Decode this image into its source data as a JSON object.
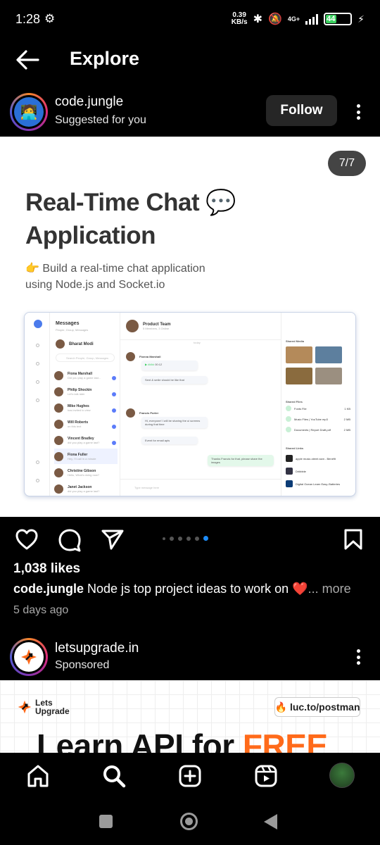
{
  "status": {
    "time": "1:28",
    "net_speed_value": "0.39",
    "net_speed_unit": "KB/s",
    "network": "4G+",
    "battery": "44"
  },
  "header": {
    "title": "Explore"
  },
  "post": {
    "username": "code.jungle",
    "subtitle": "Suggested for you",
    "follow_label": "Follow",
    "slide_counter": "7/7",
    "image": {
      "title_line1": "Real-Time Chat 💬",
      "title_line2": "Application",
      "desc_line1": "👉 Build a real-time chat application",
      "desc_line2": "using Node.js and Socket.io",
      "mock": {
        "messages_title": "Messages",
        "messages_sub": "People, Group, Messages",
        "me_name": "Bharat Modi",
        "search_placeholder": "Search People, Group, Messages",
        "contacts": [
          {
            "name": "Fiona Marshall",
            "preview": "Did you play a game last..."
          },
          {
            "name": "Philip Shockin",
            "preview": "Let's talk later"
          },
          {
            "name": "Mike Hughes",
            "preview": "has invited to view"
          },
          {
            "name": "Will Roberts",
            "preview": "on this text"
          },
          {
            "name": "Vincent Bradley",
            "preview": "did you play a game last?"
          },
          {
            "name": "Fiona Fuller",
            "preview": "Hey, I'll call in a minute"
          },
          {
            "name": "Christine Gibson",
            "preview": "Hello, What's doing now?"
          },
          {
            "name": "Janet Jackson",
            "preview": "did you play a game last?"
          }
        ],
        "chat_title": "Product Team",
        "chat_sub": "5 Members, 3 Online",
        "today": "today",
        "sender1": "Fionna Marshall",
        "msg_audio_time": "00:12",
        "msg1": "Sent & smile should be like that",
        "sender2": "Francis Porter",
        "msg2": "Hi, everyone! I will be sharing the ui screens during that time",
        "msg3": "Event for email apis",
        "msg4": "Thanks Francis for that, please share the images",
        "input_placeholder": "Type message here",
        "shared_media": "Shared Media",
        "shared_files": "Shared Files",
        "files": [
          "Fonts File",
          "Music Files | YouTube mp3",
          "Documents | Report Draft.pdf"
        ],
        "file_sizes": [
          "1 KB",
          "2 MB",
          "2 MB"
        ],
        "shared_links": "Shared Links",
        "links": [
          "apple music.otemt.ssm - Benefit",
          "Dribbble",
          "Digital Ocean Learn Easy..Batteries"
        ],
        "view_all": "View All"
      }
    },
    "likes": "1,038 likes",
    "caption_user": "code.jungle",
    "caption_text": " Node js top project ideas to work on ❤️",
    "caption_more": "... more",
    "time_ago": "5 days ago"
  },
  "post2": {
    "username": "letsupgrade.in",
    "subtitle": "Sponsored",
    "ad": {
      "brand_line1": "Lets",
      "brand_line2": "Upgrade",
      "link": "luc.to/postman",
      "headline_main": "Learn API for ",
      "headline_accent": "FREE"
    }
  },
  "icons": {
    "back": "arrow-left-icon",
    "like": "heart-icon",
    "comment": "comment-icon",
    "share": "send-icon",
    "save": "bookmark-icon",
    "home": "home-icon",
    "search": "search-icon",
    "create": "plus-square-icon",
    "reels": "reels-icon"
  },
  "colors": {
    "background": "#000000",
    "follow_button": "#262626",
    "carousel_active_dot": "#1d8cf8",
    "ad_accent": "#ff6a1a"
  }
}
